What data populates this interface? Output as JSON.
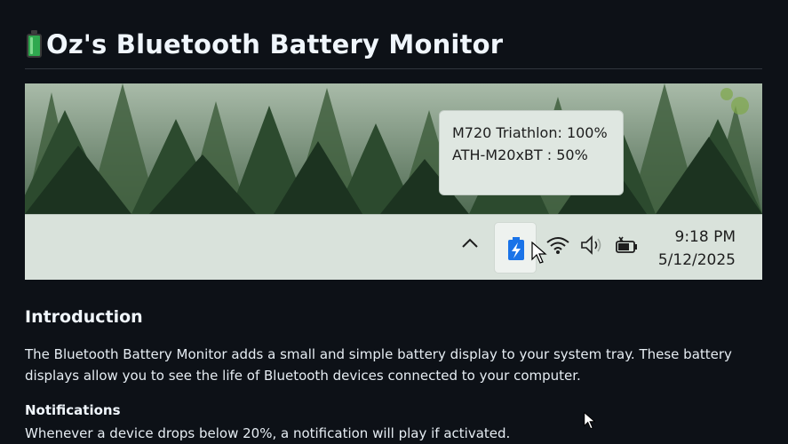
{
  "page": {
    "title": "Oz's Bluetooth Battery Monitor",
    "title_icon": "battery-icon"
  },
  "banner": {
    "tooltip": {
      "line1": "M720 Triathlon: 100%",
      "line2": "ATH-M20xBT : 50%"
    },
    "taskbar": {
      "icons": [
        "chevron-up-icon",
        "battery-tray-icon",
        "wifi-icon",
        "volume-icon",
        "power-icon"
      ],
      "time": "9:18 PM",
      "date": "5/12/2025"
    }
  },
  "sections": {
    "intro_heading": "Introduction",
    "intro_text": "The Bluetooth Battery Monitor adds a small and simple battery display to your system tray. These battery displays allow you to see the life of Bluetooth devices connected to your computer.",
    "notifications_heading": "Notifications",
    "notifications_text": "Whenever a device drops below 20%, a notification will play if activated."
  },
  "colors": {
    "background": "#0d1117",
    "text": "#e6edf3",
    "battery_green": "#2fa84f",
    "tray_battery_blue": "#1a73e8"
  }
}
